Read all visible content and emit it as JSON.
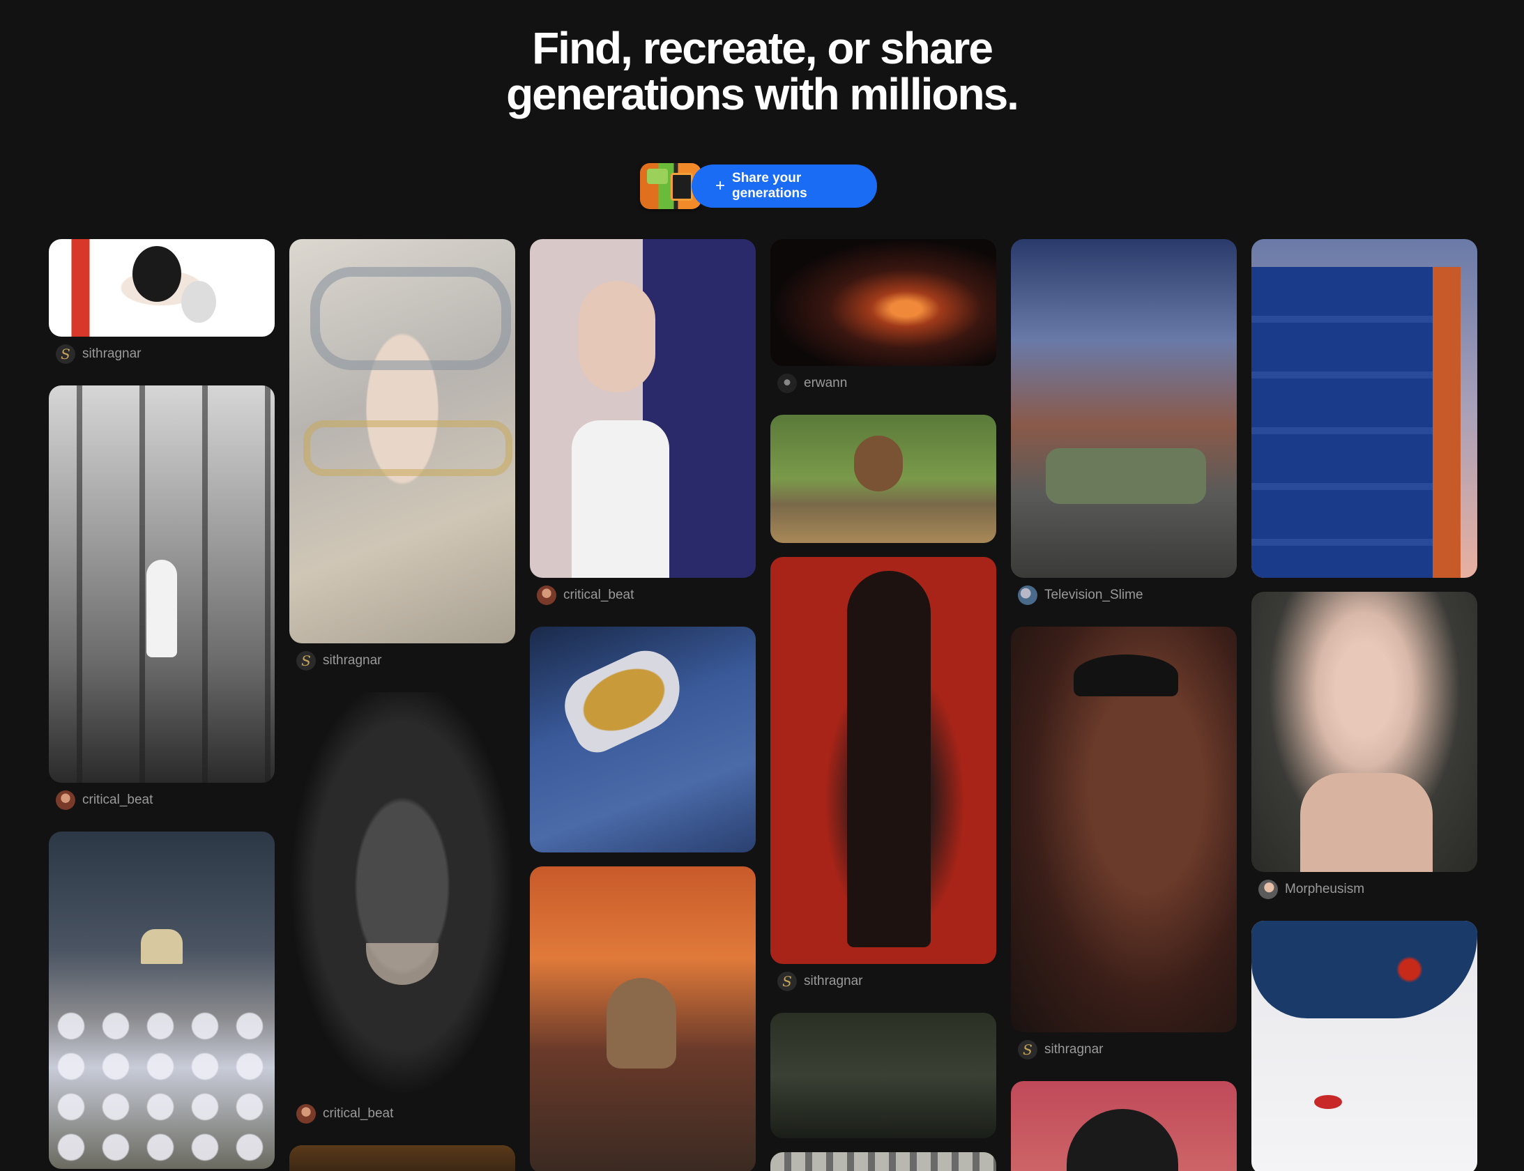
{
  "hero": {
    "title_line1": "Find, recreate, or share",
    "title_line2": "generations with millions."
  },
  "cta": {
    "plus": "+",
    "label": "Share your generations"
  },
  "icons": {
    "sithragnar_avatar": "S"
  },
  "cards": {
    "c1_user": "sithragnar",
    "c2_user": "critical_beat",
    "c3_user": "sithragnar",
    "c4_user": "critical_beat",
    "c5_user": "critical_beat",
    "c6_user": "erwann",
    "c7_user": "sithragnar",
    "c8_user": "Television_Slime",
    "c9_user": "sithragnar",
    "c10_user": "Morpheusism"
  },
  "colors": {
    "background": "#121212",
    "accent": "#1a6cf5",
    "username": "#9a9a9a"
  }
}
